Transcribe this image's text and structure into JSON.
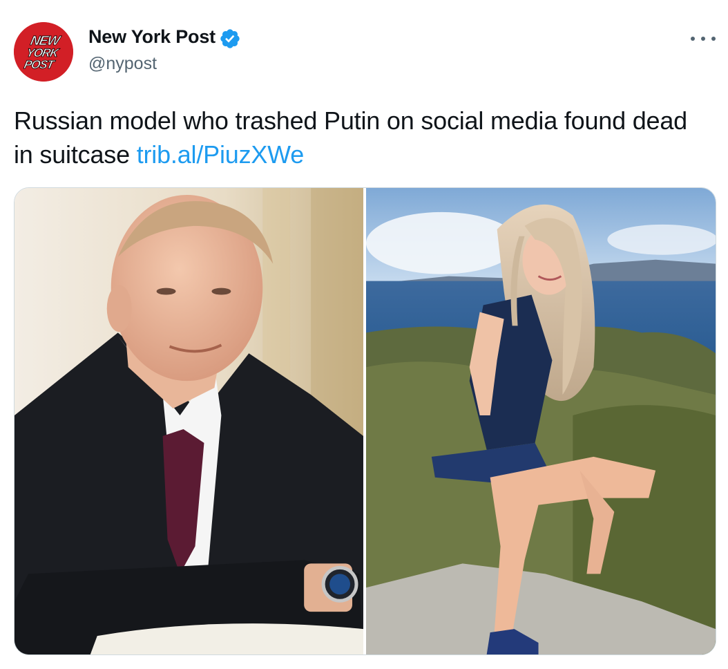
{
  "author": {
    "name": "New York Post",
    "handle": "@nypost",
    "avatar_text": [
      "NEW",
      "YORK",
      "POST"
    ],
    "verified": true
  },
  "tweet": {
    "text": "Russian model who trashed Putin on social media found dead in suitcase ",
    "link": "trib.al/PiuzXWe"
  },
  "icons": {
    "verified": "verified-badge-icon",
    "more": "more-options-icon"
  },
  "colors": {
    "link": "#1d9bf0",
    "verified": "#1d9bf0",
    "brand": "#d21f26",
    "secondary_text": "#536471"
  }
}
